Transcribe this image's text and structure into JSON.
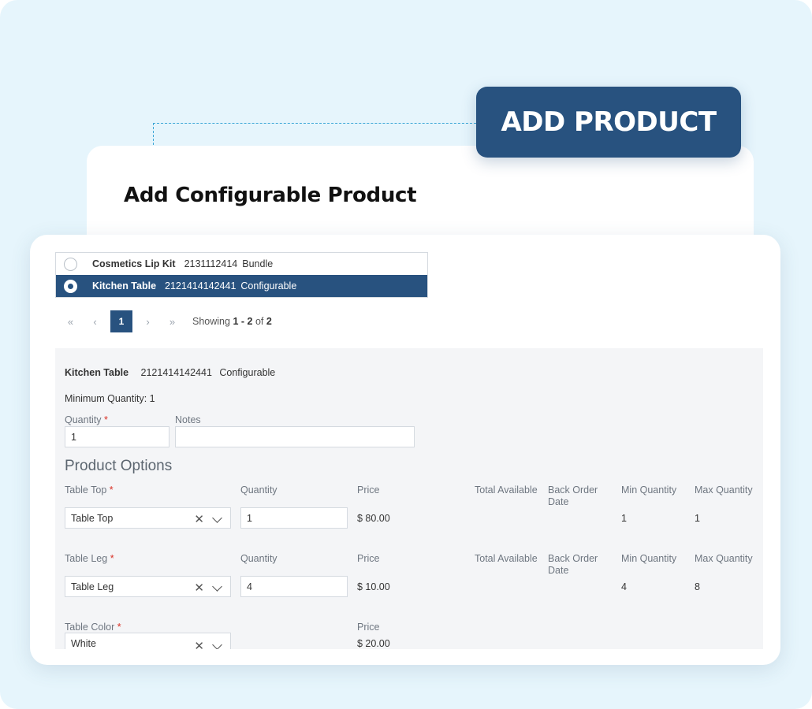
{
  "badge": {
    "label": "ADD PRODUCT"
  },
  "back_card": {
    "title": "Add Configurable Product"
  },
  "products": [
    {
      "name": "Cosmetics Lip Kit",
      "sku": "2131112414",
      "type": "Bundle",
      "selected": false
    },
    {
      "name": "Kitchen Table",
      "sku": "2121414142441",
      "type": "Configurable",
      "selected": true
    }
  ],
  "pagination": {
    "first": "«",
    "prev": "‹",
    "current": "1",
    "next": "›",
    "last": "»",
    "showing_prefix": "Showing",
    "range": "1 - 2",
    "of": "of",
    "total": "2"
  },
  "detail": {
    "product_name": "Kitchen Table",
    "product_sku": "2121414142441",
    "product_type": "Configurable",
    "min_quantity": "Minimum Quantity: 1",
    "quantity_label": "Quantity",
    "required_mark": "*",
    "quantity_value": "1",
    "notes_label": "Notes",
    "notes_value": "",
    "options_title": "Product Options"
  },
  "options": [
    {
      "label": "Table Top",
      "qty_label": "Quantity",
      "price_label": "Price",
      "total_label": "Total Available",
      "back_label": "Back Order Date",
      "min_label": "Min Quantity",
      "max_label": "Max Quantity",
      "value": "Table Top",
      "qty": "1",
      "price": "$ 80.00",
      "min": "1",
      "max": "1"
    },
    {
      "label": "Table Leg",
      "qty_label": "Quantity",
      "price_label": "Price",
      "total_label": "Total Available",
      "back_label": "Back Order Date",
      "min_label": "Min Quantity",
      "max_label": "Max Quantity",
      "value": "Table Leg",
      "qty": "4",
      "price": "$ 10.00",
      "min": "4",
      "max": "8"
    },
    {
      "label": "Table Color",
      "price_label": "Price",
      "value": "White",
      "price": "$ 20.00"
    }
  ],
  "icons": {
    "clear": "close-icon",
    "dropdown": "chevron-down-icon"
  },
  "colors": {
    "brand": "#28527f",
    "background": "#e6f5fc",
    "required": "#d93025"
  }
}
